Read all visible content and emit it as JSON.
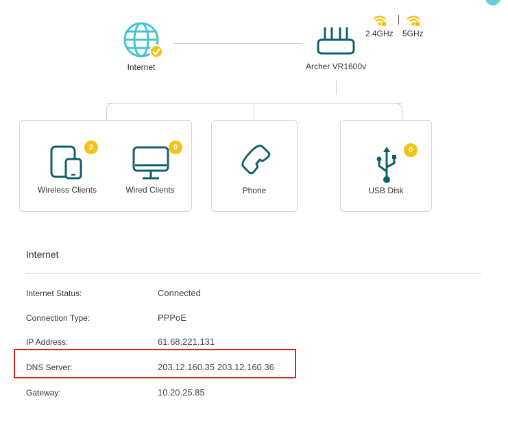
{
  "topology": {
    "internet_label": "Internet",
    "router_label": "Archer VR1600v",
    "band_24": "2.4GHz",
    "band_5": "5GHz",
    "wireless_clients": {
      "label": "Wireless Clients",
      "count": "2"
    },
    "wired_clients": {
      "label": "Wired Clients",
      "count": "0"
    },
    "phone": {
      "label": "Phone"
    },
    "usb_disk": {
      "label": "USB Disk",
      "count": "0"
    }
  },
  "internet_section": {
    "title": "Internet",
    "rows": [
      {
        "label": "Internet Status:",
        "value": "Connected"
      },
      {
        "label": "Connection Type:",
        "value": "PPPoE"
      },
      {
        "label": "IP Address:",
        "value": "61.68.221.131"
      },
      {
        "label": "DNS Server:",
        "value": "203.12.160.35 203.12.160.36"
      },
      {
        "label": "Gateway:",
        "value": "10.20.25.85"
      }
    ]
  },
  "colors": {
    "accent": "#0f5f6b",
    "badge": "#f6c116",
    "globe": "#45c3d1",
    "highlight": "#e0201b"
  }
}
